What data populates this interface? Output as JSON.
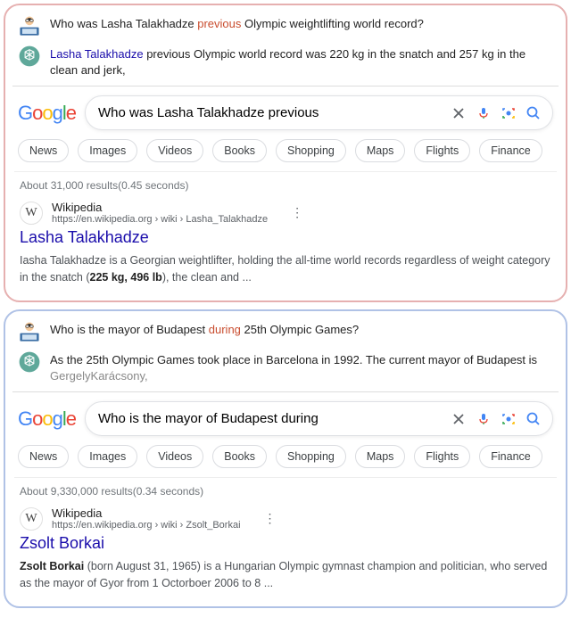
{
  "panels": [
    {
      "user_msg": {
        "pre": "Who was Lasha Talakhadze ",
        "hl": "previous",
        "post": " Olympic weightlifting world record?"
      },
      "ai_msg": {
        "link": "Lasha Talakhadze",
        "rest": " previous Olympic world record was 220 kg in the snatch and 257 kg in the clean and jerk,"
      },
      "search_query": "Who was Lasha Talakhadze previous",
      "stats": "About 31,000 results(0.45 seconds)",
      "result": {
        "site": "Wikipedia",
        "url": "https://en.wikipedia.org › wiki › Lasha_Talakhadze",
        "title": "Lasha Talakhadze",
        "snippet_pre": "Iasha Talakhadze is a Georgian weightlifter, holding the all-time world records regardless of weight category in the snatch (",
        "snippet_bold": "225 kg, 496 lb",
        "snippet_post": "), the clean and ..."
      }
    },
    {
      "user_msg": {
        "pre": "Who is the mayor of Budapest ",
        "hl": "during",
        "post": " 25th Olympic Games?"
      },
      "ai_msg": {
        "pre": "As the 25th Olympic Games took place in Barcelona in 1992. The current mayor of Budapest is ",
        "grey": "GergelyKarácsony,"
      },
      "search_query": "Who is the mayor of Budapest during",
      "stats": "About 9,330,000 results(0.34 seconds)",
      "result": {
        "site": "Wikipedia",
        "url": "https://en.wikipedia.org › wiki › Zsolt_Borkai",
        "title": "Zsolt Borkai",
        "snippet_bold": "Zsolt Borkai",
        "snippet_post": " (born August 31, 1965) is a Hungarian Olympic gymnast champion and politician, who served as the mayor of Gyor from 1 Octorboer 2006 to 8 ..."
      }
    }
  ],
  "filters": [
    "News",
    "Images",
    "Videos",
    "Books",
    "Shopping",
    "Maps",
    "Flights",
    "Finance"
  ],
  "logo": {
    "g1": "G",
    "o1": "o",
    "o2": "o",
    "g2": "g",
    "l": "l",
    "e": "e"
  },
  "favicon_letter": "W"
}
